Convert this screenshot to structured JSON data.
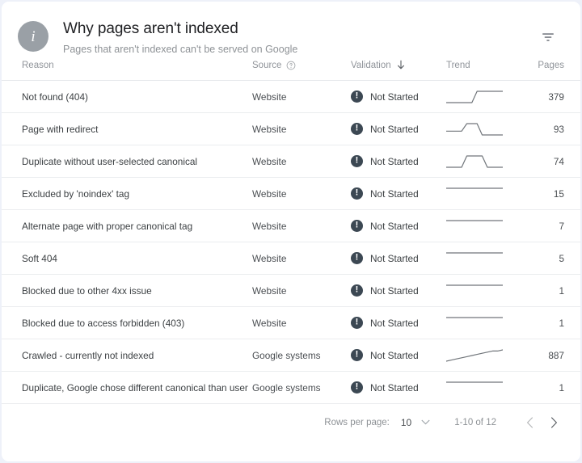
{
  "header": {
    "avatar_icon": "info-icon",
    "avatar_glyph": "i",
    "title": "Why pages aren't indexed",
    "subtitle": "Pages that aren't indexed can't be served on Google",
    "filter_icon": "filter-icon"
  },
  "table": {
    "columns": [
      {
        "key": "reason",
        "label": "Reason"
      },
      {
        "key": "source",
        "label": "Source",
        "help_icon": "help-circle-icon"
      },
      {
        "key": "validation",
        "label": "Validation",
        "sort_icon": "arrow-down-icon",
        "sorted": true
      },
      {
        "key": "trend",
        "label": "Trend"
      },
      {
        "key": "pages",
        "label": "Pages"
      }
    ],
    "rows": [
      {
        "reason": "Not found (404)",
        "source": "Website",
        "status_icon": "alert-icon",
        "validation": "Not Started",
        "pages": "379",
        "trend": [
          6,
          6,
          6,
          6,
          6,
          6,
          4,
          4,
          4,
          4,
          4,
          4
        ]
      },
      {
        "reason": "Page with redirect",
        "source": "Website",
        "status_icon": "alert-icon",
        "validation": "Not Started",
        "pages": "93",
        "trend": [
          6,
          6,
          6,
          6,
          4,
          4,
          4,
          7,
          7,
          7,
          7,
          7
        ]
      },
      {
        "reason": "Duplicate without user-selected canonical",
        "source": "Website",
        "status_icon": "alert-icon",
        "validation": "Not Started",
        "pages": "74",
        "trend": [
          7,
          7,
          7,
          7,
          5,
          5,
          5,
          5,
          7,
          7,
          7,
          7
        ]
      },
      {
        "reason": "Excluded by 'noindex' tag",
        "source": "Website",
        "status_icon": "alert-icon",
        "validation": "Not Started",
        "pages": "15",
        "trend": [
          6,
          6,
          6,
          6,
          6,
          6,
          6,
          6,
          6,
          6,
          6,
          6
        ]
      },
      {
        "reason": "Alternate page with proper canonical tag",
        "source": "Website",
        "status_icon": "alert-icon",
        "validation": "Not Started",
        "pages": "7",
        "trend": [
          6,
          6,
          6,
          6,
          6,
          6,
          6,
          6,
          6,
          6,
          6,
          6
        ]
      },
      {
        "reason": "Soft 404",
        "source": "Website",
        "status_icon": "alert-icon",
        "validation": "Not Started",
        "pages": "5",
        "trend": [
          6,
          6,
          6,
          6,
          6,
          6,
          6,
          6,
          6,
          6,
          6,
          6
        ]
      },
      {
        "reason": "Blocked due to other 4xx issue",
        "source": "Website",
        "status_icon": "alert-icon",
        "validation": "Not Started",
        "pages": "1",
        "trend": [
          6,
          6,
          6,
          6,
          6,
          6,
          6,
          6,
          6,
          6,
          6,
          6
        ]
      },
      {
        "reason": "Blocked due to access forbidden (403)",
        "source": "Website",
        "status_icon": "alert-icon",
        "validation": "Not Started",
        "pages": "1",
        "trend": [
          6,
          6,
          6,
          6,
          6,
          6,
          6,
          6,
          6,
          6,
          6,
          6
        ]
      },
      {
        "reason": "Crawled - currently not indexed",
        "source": "Google systems",
        "status_icon": "alert-icon",
        "validation": "Not Started",
        "pages": "887",
        "trend": [
          11,
          10,
          9,
          8,
          7,
          6,
          5,
          4,
          3,
          2,
          2,
          1
        ]
      },
      {
        "reason": "Duplicate, Google chose different canonical than user",
        "source": "Google systems",
        "status_icon": "alert-icon",
        "validation": "Not Started",
        "pages": "1",
        "trend": [
          6,
          6,
          6,
          6,
          6,
          6,
          6,
          6,
          6,
          6,
          6,
          6
        ]
      }
    ]
  },
  "footer": {
    "rows_per_page_label": "Rows per page:",
    "rows_per_page_value": "10",
    "dropdown_icon": "chevron-down-icon",
    "range_label": "1-10 of 12",
    "prev_icon": "chevron-left-icon",
    "next_icon": "chevron-right-icon"
  },
  "colors": {
    "status": "#3c4853",
    "page_bg": "#eef1f9",
    "card_bg": "#ffffff",
    "divider": "#ebedef",
    "muted_text": "#90949a"
  }
}
